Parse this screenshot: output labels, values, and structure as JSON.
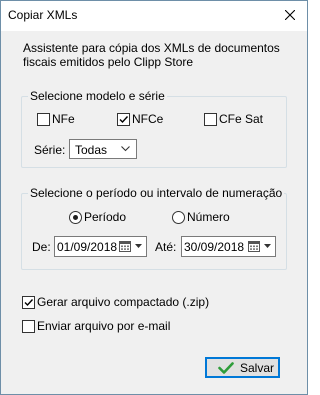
{
  "window": {
    "title": "Copiar XMLs"
  },
  "intro": {
    "line1": "Assistente para cópia dos XMLs de documentos",
    "line2": "fiscais emitidos pelo Clipp Store"
  },
  "model_group": {
    "title": "Selecione modelo e série",
    "options": [
      {
        "label": "NFe",
        "checked": false
      },
      {
        "label": "NFCe",
        "checked": true
      },
      {
        "label": "CFe Sat",
        "checked": false
      }
    ],
    "serie_label": "Série:",
    "serie_value": "Todas"
  },
  "period_group": {
    "title": "Selecione o período ou intervalo de numeração",
    "radio_periodo": {
      "label": "Período",
      "selected": true
    },
    "radio_numero": {
      "label": "Número",
      "selected": false
    },
    "from_label": "De:",
    "from_value": "01/09/2018",
    "to_label": "Até:",
    "to_value": "30/09/2018"
  },
  "options": {
    "zip": {
      "label": "Gerar arquivo compactado (.zip)",
      "checked": true
    },
    "email": {
      "label": "Enviar arquivo por e-mail",
      "checked": false
    }
  },
  "actions": {
    "save_label": "Salvar"
  },
  "colors": {
    "frame_border": "#6e8fa8",
    "dialog_bg": "#f0f0f0",
    "button_focus": "#0078d7",
    "save_check": "#2e9d3a"
  },
  "icons": {
    "close": "close-icon",
    "checkmark": "checkmark-icon",
    "calendar": "calendar-icon",
    "chevron": "chevron-down-icon",
    "save": "green-check-icon"
  }
}
